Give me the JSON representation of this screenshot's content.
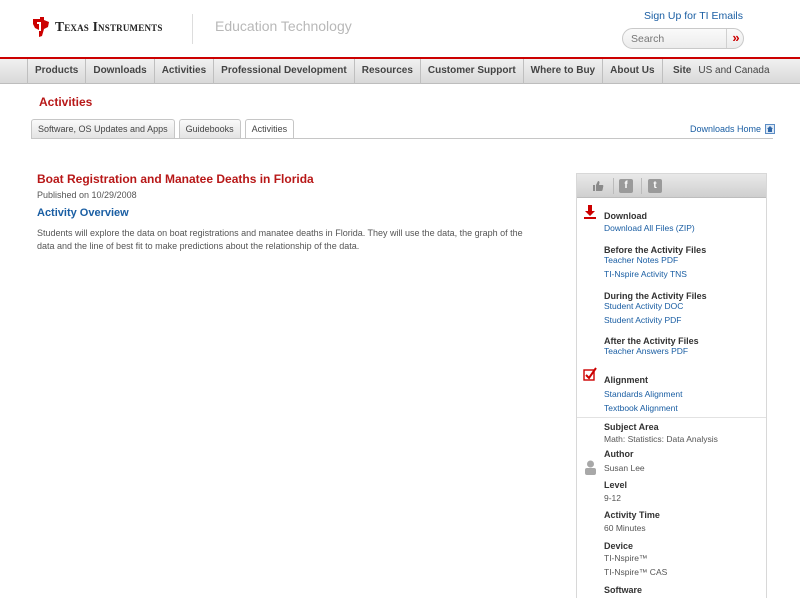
{
  "header": {
    "logo_text": "Texas Instruments",
    "tagline": "Education Technology",
    "signup_link": "Sign Up for TI Emails",
    "search_placeholder": "Search",
    "search_button": "»"
  },
  "nav": {
    "items": [
      "Products",
      "Downloads",
      "Activities",
      "Professional Development",
      "Resources",
      "Customer Support",
      "Where to Buy",
      "About Us"
    ],
    "site_label": "Site",
    "site_value": "US and Canada"
  },
  "section_title": "Activities",
  "tabs": [
    "Software, OS Updates and Apps",
    "Guidebooks",
    "Activities"
  ],
  "active_tab": "Activities",
  "downloads_home": "Downloads Home",
  "activity": {
    "title": "Boat Registration and Manatee Deaths in Florida",
    "published": "Published on 10/29/2008",
    "overview_heading": "Activity Overview",
    "description": "Students will explore the data on boat registrations and manatee deaths in Florida. They will use the data, the graph of the data and the line of best fit to make predictions about the relationship of the data."
  },
  "sidebar": {
    "share_icons": [
      "thumbs-up-icon",
      "facebook-icon",
      "twitter-icon"
    ],
    "download_heading": "Download",
    "download_all": "Download All Files (ZIP)",
    "before_heading": "Before the Activity Files",
    "before_links": [
      "Teacher Notes PDF",
      "TI-Nspire Activity TNS"
    ],
    "during_heading": "During the Activity Files",
    "during_links": [
      "Student Activity DOC",
      "Student Activity PDF"
    ],
    "after_heading": "After the Activity Files",
    "after_links": [
      "Teacher Answers PDF"
    ],
    "alignment_heading": "Alignment",
    "alignment_links": [
      "Standards Alignment",
      "Textbook Alignment"
    ],
    "subject_heading": "Subject Area",
    "subject_value": "Math: Statistics: Data Analysis",
    "author_heading": "Author",
    "author_value": "Susan Lee",
    "level_heading": "Level",
    "level_value": "9-12",
    "time_heading": "Activity Time",
    "time_value": "60 Minutes",
    "device_heading": "Device",
    "device_values": [
      "TI-Nspire™",
      "TI-Nspire™ CAS"
    ],
    "software_heading": "Software"
  },
  "colors": {
    "brand_red": "#c00000",
    "link_blue": "#1a5ea3"
  }
}
